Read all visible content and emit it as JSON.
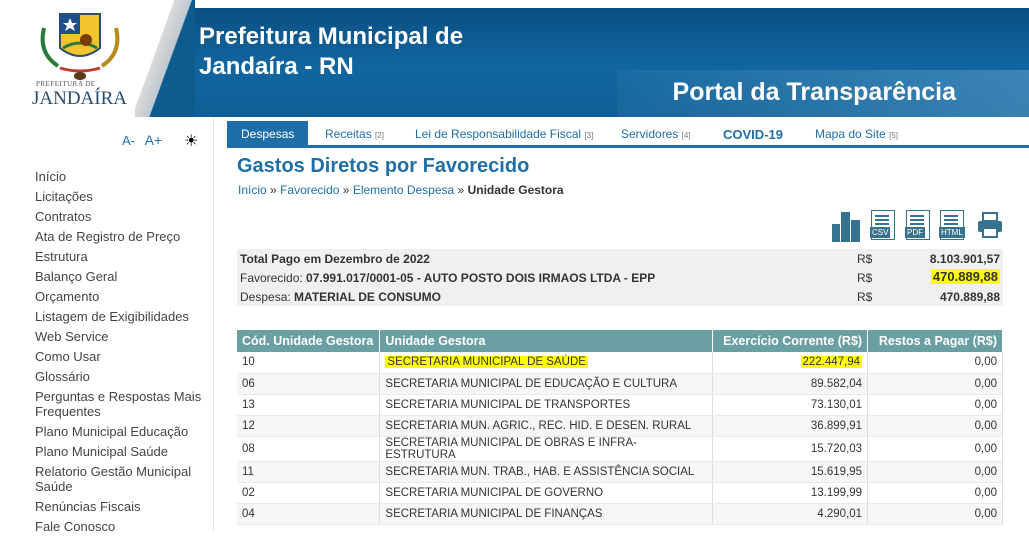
{
  "header": {
    "title_line1": "Prefeitura Municipal de",
    "title_line2": "Jandaíra - RN",
    "portal": "Portal da Transparência",
    "logo_small": "PREFEITURA DE",
    "logo_name": "JANDAÍRA"
  },
  "sidebar": {
    "font_decrease": "A-",
    "font_increase": "A+",
    "contrast_icon": "☀",
    "items": [
      "Início",
      "Licitações",
      "Contratos",
      "Ata de Registro de Preço",
      "Estrutura",
      "Balanço Geral",
      "Orçamento",
      "Listagem de Exigibilidades",
      "Web Service",
      "Como Usar",
      "Glossário",
      "Perguntas e Respostas Mais Frequentes",
      "Plano Municipal Educação",
      "Plano Municipal Saúde",
      "Relatorio Gestão Municipal Saúde",
      "Renúncias Fiscais",
      "Fale Conosco"
    ]
  },
  "tabs": [
    {
      "label": "Despesas",
      "count": ""
    },
    {
      "label": "Receitas",
      "count": "[2]"
    },
    {
      "label": "Lei de Responsabilidade Fiscal",
      "count": "[3]"
    },
    {
      "label": "Servidores",
      "count": "[4]"
    },
    {
      "label": "COVID-19",
      "count": ""
    },
    {
      "label": "Mapa do Site",
      "count": "[5]"
    }
  ],
  "page": {
    "title": "Gastos Diretos por Favorecido",
    "breadcrumb": [
      "Início",
      "Favorecido",
      "Elemento Despesa",
      "Unidade Gestora"
    ],
    "breadcrumb_sep": "»"
  },
  "exports": [
    "CSV",
    "PDF",
    "HTML"
  ],
  "summary": {
    "total_label": "Total Pago em Dezembro de 2022",
    "total_currency": "R$",
    "total_value": "8.103.901,57",
    "favorecido_label": "Favorecido:",
    "favorecido_value": "07.991.017/0001-05 - AUTO POSTO DOIS IRMAOS LTDA - EPP",
    "favorecido_currency": "R$",
    "favorecido_amount": "470.889,88",
    "despesa_label": "Despesa:",
    "despesa_value": "MATERIAL DE CONSUMO",
    "despesa_currency": "R$",
    "despesa_amount": "470.889,88"
  },
  "table": {
    "headers": [
      "Cód. Unidade Gestora",
      "Unidade Gestora",
      "Exercício Corrente (R$)",
      "Restos a Pagar (R$)"
    ],
    "rows": [
      [
        "10",
        "SECRETARIA MUNICIPAL DE SAÚDE",
        "222.447,94",
        "0,00"
      ],
      [
        "06",
        "SECRETARIA MUNICIPAL DE EDUCAÇÃO E CULTURA",
        "89.582,04",
        "0,00"
      ],
      [
        "13",
        "SECRETARIA MUNICIPAL DE TRANSPORTES",
        "73.130,01",
        "0,00"
      ],
      [
        "12",
        "SECRETARIA MUN. AGRIC., REC. HID. E DESEN. RURAL",
        "36.899,91",
        "0,00"
      ],
      [
        "08",
        "SECRETARIA MUNICIPAL DE OBRAS E INFRA-ESTRUTURA",
        "15.720,03",
        "0,00"
      ],
      [
        "11",
        "SECRETARIA MUN. TRAB., HAB. E ASSISTÊNCIA SOCIAL",
        "15.619,95",
        "0,00"
      ],
      [
        "02",
        "SECRETARIA MUNICIPAL DE GOVERNO",
        "13.199,99",
        "0,00"
      ],
      [
        "04",
        "SECRETARIA MUNICIPAL DE FINANÇAS",
        "4.290,01",
        "0,00"
      ]
    ]
  },
  "colors": {
    "header_blue": "#0d5b8f",
    "link_blue": "#1e6fa8",
    "table_header": "#6a9fa3",
    "highlight": "#ffff00"
  }
}
